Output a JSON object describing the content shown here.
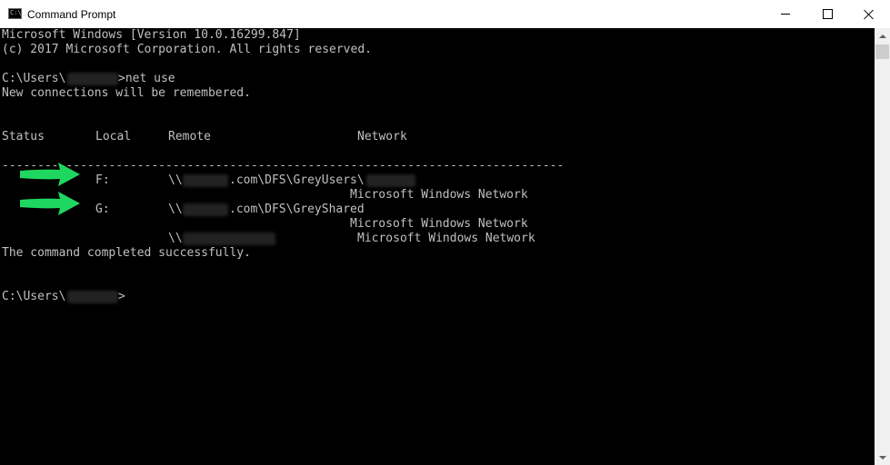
{
  "window": {
    "title": "Command Prompt",
    "icon": "cmd-icon",
    "icon_glyph": "C:\\_",
    "controls": [
      "minimize-icon",
      "maximize-icon",
      "close-icon"
    ]
  },
  "colors": {
    "console_background": "#000000",
    "console_text": "#c0c0c0",
    "arrow": "#1ed760"
  },
  "console": {
    "banner": [
      "Microsoft Windows [Version 10.0.16299.847]",
      "(c) 2017 Microsoft Corporation. All rights reserved."
    ],
    "command_prompt": "C:\\Users\\",
    "command": ">net use",
    "remember_message": "New connections will be remembered.",
    "table": {
      "headers": [
        "Status",
        "Local",
        "Remote",
        "Network"
      ],
      "separator": "-------------------------------------------------------------------------------",
      "rows": [
        {
          "local": "F:",
          "remote_prefix": "\\\\",
          "remote_path": ".com\\DFS\\GreyUsers\\",
          "network": "Microsoft Windows Network"
        },
        {
          "local": "G:",
          "remote_prefix": "\\\\",
          "remote_path": ".com\\DFS\\GreyShared",
          "network": "Microsoft Windows Network"
        },
        {
          "local": "",
          "remote_prefix": "\\\\",
          "remote_path": "",
          "network": "Microsoft Windows Network"
        }
      ]
    },
    "completion_message": "The command completed successfully.",
    "final_prompt": "C:\\Users\\",
    "final_prompt_suffix": ">"
  }
}
